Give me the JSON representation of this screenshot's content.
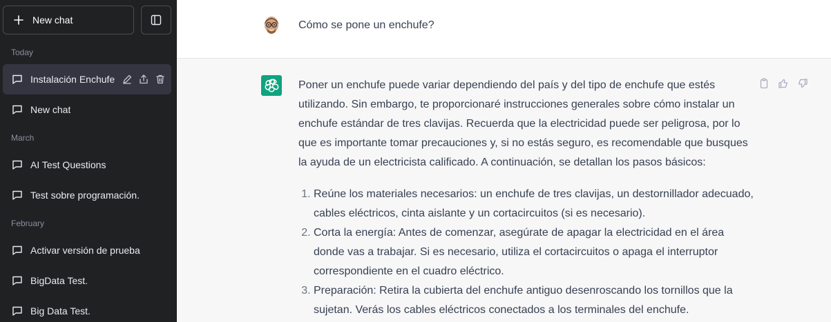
{
  "sidebar": {
    "new_chat_label": "New chat",
    "sections": [
      {
        "label": "Today",
        "items": [
          {
            "label": "Instalación Enchufe",
            "active": true
          },
          {
            "label": "New chat"
          }
        ]
      },
      {
        "label": "March",
        "items": [
          {
            "label": "AI Test Questions"
          },
          {
            "label": "Test sobre programación."
          }
        ]
      },
      {
        "label": "February",
        "items": [
          {
            "label": "Activar versión de prueba"
          },
          {
            "label": "BigData Test."
          },
          {
            "label": "Big Data Test."
          }
        ]
      }
    ]
  },
  "conversation": {
    "user_message": "Cómo se pone un enchufe?",
    "assistant": {
      "intro": "Poner un enchufe puede variar dependiendo del país y del tipo de enchufe que estés utilizando. Sin embargo, te proporcionaré instrucciones generales sobre cómo instalar un enchufe estándar de tres clavijas. Recuerda que la electricidad puede ser peligrosa, por lo que es importante tomar precauciones y, si no estás seguro, es recomendable que busques la ayuda de un electricista calificado. A continuación, se detallan los pasos básicos:",
      "steps": [
        "Reúne los materiales necesarios: un enchufe de tres clavijas, un destornillador adecuado, cables eléctricos, cinta aislante y un cortacircuitos (si es necesario).",
        "Corta la energía: Antes de comenzar, asegúrate de apagar la electricidad en el área donde vas a trabajar. Si es necesario, utiliza el cortacircuitos o apaga el interruptor correspondiente en el cuadro eléctrico.",
        "Preparación: Retira la cubierta del enchufe antiguo desenroscando los tornillos que la sujetan. Verás los cables eléctricos conectados a los terminales del enchufe."
      ]
    }
  },
  "icons": {
    "new_chat": "plus-icon",
    "toggle": "sidebar-toggle-icon",
    "chat": "message-icon",
    "edit": "pencil-icon",
    "share": "share-icon",
    "delete": "trash-icon",
    "copy": "clipboard-icon",
    "like": "thumbs-up-icon",
    "dislike": "thumbs-down-icon",
    "assistant_logo": "openai-logo-icon"
  },
  "colors": {
    "sidebar_bg": "#202123",
    "active_item_bg": "#343541",
    "assistant_row_bg": "#f7f7f8",
    "accent": "#10a37f"
  }
}
